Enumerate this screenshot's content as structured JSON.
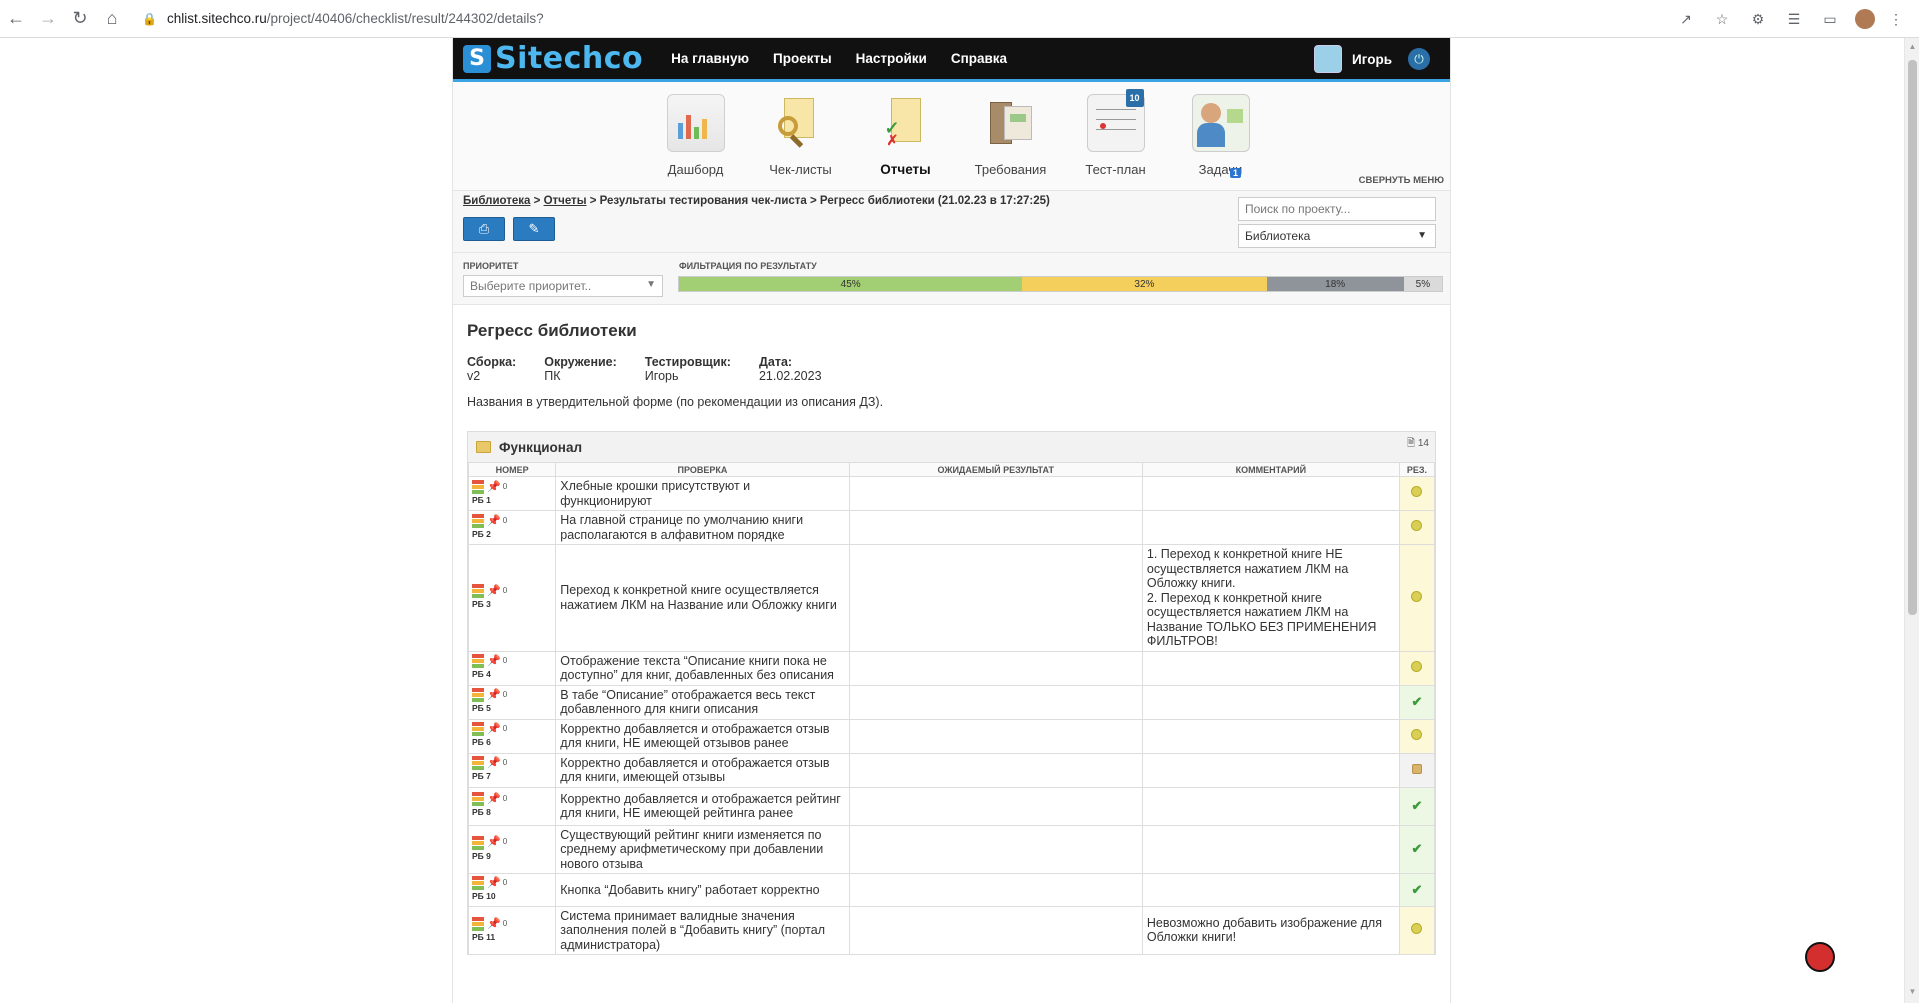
{
  "browser": {
    "url_host": "chlist.sitechco.ru",
    "url_path": "/project/40406/checklist/result/244302/details?"
  },
  "header": {
    "logo_text": "Sitechco",
    "nav": [
      "На главную",
      "Проекты",
      "Настройки",
      "Справка"
    ],
    "user_name": "Игорь"
  },
  "menu": {
    "items": [
      {
        "label": "Дашборд"
      },
      {
        "label": "Чек-листы"
      },
      {
        "label": "Отчеты"
      },
      {
        "label": "Требования"
      },
      {
        "label": "Тест-план"
      },
      {
        "label": "Задачи"
      }
    ],
    "tasks_badge": "1",
    "testplan_day": "10",
    "collapse_label": "СВЕРНУТЬ МЕНЮ"
  },
  "breadcrumb": {
    "library": "Библиотека",
    "reports": "Отчеты",
    "rest": " > Результаты тестирования чек-листа > Регресс библиотеки (21.02.23 в 17:27:25)",
    "sep": " > "
  },
  "search": {
    "placeholder": "Поиск по проекту..."
  },
  "project_select": {
    "value": "Библиотека"
  },
  "filters": {
    "priority_label": "ПРИОРИТЕТ",
    "priority_placeholder": "Выберите приоритет..",
    "result_label": "ФИЛЬТРАЦИЯ ПО РЕЗУЛЬТАТУ",
    "segments": [
      {
        "label": "45%",
        "value": 45,
        "color": "#a2cf73"
      },
      {
        "label": "32%",
        "value": 32,
        "color": "#f5cf5c"
      },
      {
        "label": "18%",
        "value": 18,
        "color": "#8e9499"
      },
      {
        "label": "5%",
        "value": 5,
        "color": "#dadada"
      }
    ]
  },
  "report": {
    "title": "Регресс библиотеки",
    "meta": [
      {
        "key": "Сборка:",
        "value": "v2"
      },
      {
        "key": "Окружение:",
        "value": "ПК"
      },
      {
        "key": "Тестировщик:",
        "value": "Игорь"
      },
      {
        "key": "Дата:",
        "value": "21.02.2023"
      }
    ],
    "description": "Названия в утвердительной форме (по рекомендации из описания ДЗ)."
  },
  "group": {
    "title": "Функционал",
    "count": "14",
    "columns": [
      "НОМЕР",
      "ПРОВЕРКА",
      "ОЖИДАЕМЫЙ РЕЗУЛЬТАТ",
      "КОММЕНТАРИЙ",
      "РЕЗ."
    ],
    "rows": [
      {
        "num": "РБ 1",
        "zero": "0",
        "check": "Хлебные крошки присутствуют и функционируют",
        "expected": "",
        "comment": "",
        "result": "bug"
      },
      {
        "num": "РБ 2",
        "zero": "0",
        "check": "На главной странице по умолчанию книги располагаются в алфавитном порядке",
        "expected": "",
        "comment": "",
        "result": "bug"
      },
      {
        "num": "РБ 3",
        "zero": "0",
        "check": "Переход к конкретной книге осуществляется нажатием ЛКМ на Название или Обложку книги",
        "expected": "",
        "comment": "1. Переход к конкретной книге НЕ осуществляется нажатием ЛКМ на Обложку книги.\n2. Переход к конкретной книге осуществляется нажатием ЛКМ на Название ТОЛЬКО БЕЗ ПРИМЕНЕНИЯ ФИЛЬТРОВ!",
        "result": "bug"
      },
      {
        "num": "РБ 4",
        "zero": "0",
        "check": "Отображение текста “Описание книги пока не доступно” для книг, добавленных без описания",
        "expected": "",
        "comment": "",
        "result": "bug"
      },
      {
        "num": "РБ 5",
        "zero": "0",
        "check": "В табе “Описание” отображается весь текст добавленного для книги описания",
        "expected": "",
        "comment": "",
        "result": "ok"
      },
      {
        "num": "РБ 6",
        "zero": "0",
        "check": "Корректно добавляется и отображается отзыв для книги, НЕ имеющей отзывов ранее",
        "expected": "",
        "comment": "",
        "result": "bug"
      },
      {
        "num": "РБ 7",
        "zero": "0",
        "check": "Корректно добавляется и отображается отзыв для книги, имеющей отзывы",
        "expected": "",
        "comment": "",
        "result": "lock"
      },
      {
        "num": "РБ 8",
        "zero": "0",
        "check": "Корректно добавляется и отображается рейтинг для книги, НЕ имеющей рейтинга ранее",
        "expected": "",
        "comment": "",
        "result": "ok"
      },
      {
        "num": "РБ 9",
        "zero": "0",
        "check": "Существующий рейтинг книги изменяется по среднему арифметическому при добавлении нового отзыва",
        "expected": "",
        "comment": "",
        "result": "ok"
      },
      {
        "num": "РБ 10",
        "zero": "0",
        "check": "Кнопка “Добавить книгу” работает корректно",
        "expected": "",
        "comment": "",
        "result": "ok"
      },
      {
        "num": "РБ 11",
        "zero": "0",
        "check": "Система принимает валидные значения заполнения полей в “Добавить книгу” (портал администратора)",
        "expected": "",
        "comment": "Невозможно добавить изображение для Обложки книги!",
        "result": "bug"
      }
    ]
  },
  "colors": {
    "priority_high": "#e4553c",
    "priority_mid": "#f2b53a",
    "priority_low": "#7fbf55"
  }
}
